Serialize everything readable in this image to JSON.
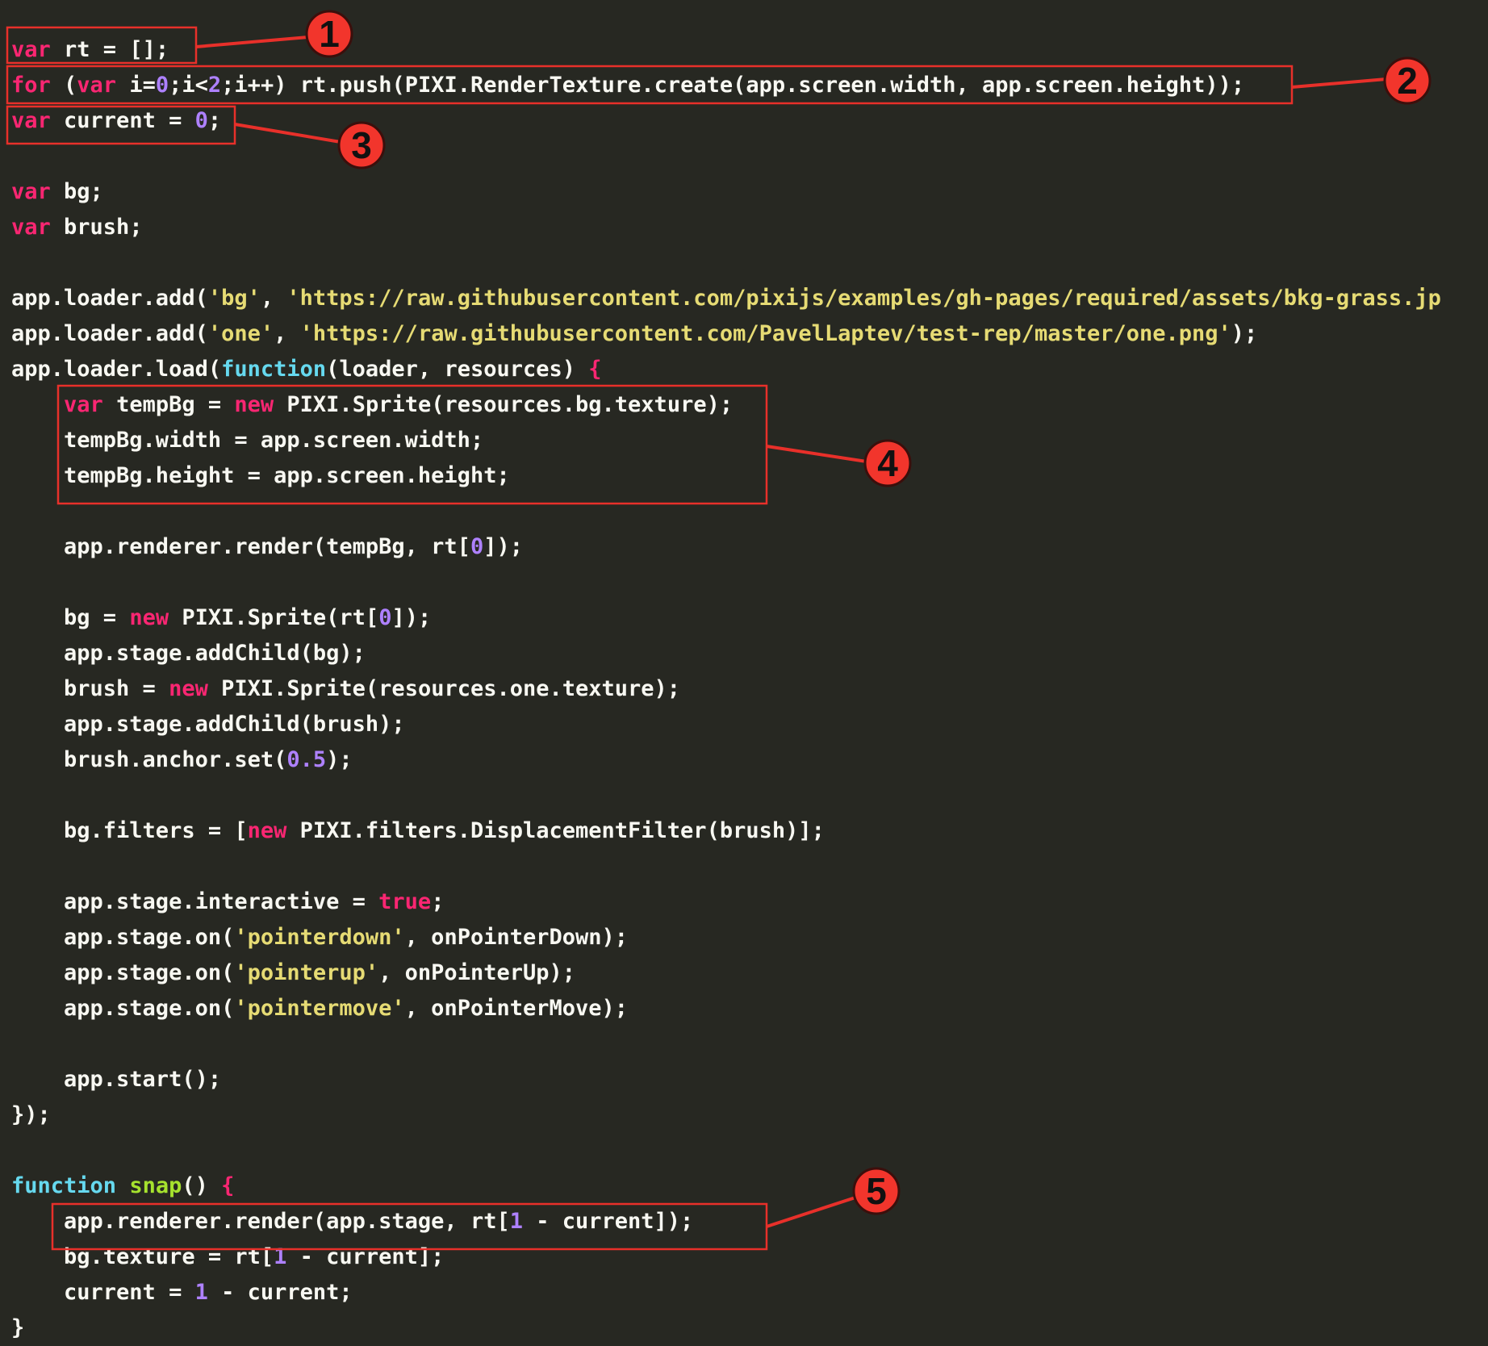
{
  "colors": {
    "background": "#272822",
    "plain": "#f8f8f2",
    "keyword": "#f92672",
    "function_keyword": "#66d9ef",
    "function_name": "#a6e22e",
    "string": "#e6db74",
    "number": "#ae81ff",
    "annotation": "#e8302a"
  },
  "code_lines": [
    [
      {
        "t": "kw",
        "v": "var"
      },
      {
        "t": "p",
        "v": " rt = [];"
      }
    ],
    [
      {
        "t": "kw",
        "v": "for"
      },
      {
        "t": "p",
        "v": " ("
      },
      {
        "t": "kw",
        "v": "var"
      },
      {
        "t": "p",
        "v": " i="
      },
      {
        "t": "num",
        "v": "0"
      },
      {
        "t": "p",
        "v": ";i<"
      },
      {
        "t": "num",
        "v": "2"
      },
      {
        "t": "p",
        "v": ";i++) rt.push(PIXI.RenderTexture.create(app.screen.width, app.screen.height));"
      }
    ],
    [
      {
        "t": "kw",
        "v": "var"
      },
      {
        "t": "p",
        "v": " current = "
      },
      {
        "t": "num",
        "v": "0"
      },
      {
        "t": "p",
        "v": ";"
      }
    ],
    [],
    [
      {
        "t": "kw",
        "v": "var"
      },
      {
        "t": "p",
        "v": " bg;"
      }
    ],
    [
      {
        "t": "kw",
        "v": "var"
      },
      {
        "t": "p",
        "v": " brush;"
      }
    ],
    [],
    [
      {
        "t": "p",
        "v": "app.loader.add("
      },
      {
        "t": "str",
        "v": "'bg'"
      },
      {
        "t": "p",
        "v": ", "
      },
      {
        "t": "str",
        "v": "'https://raw.githubusercontent.com/pixijs/examples/gh-pages/required/assets/bkg-grass.jp"
      }
    ],
    [
      {
        "t": "p",
        "v": "app.loader.add("
      },
      {
        "t": "str",
        "v": "'one'"
      },
      {
        "t": "p",
        "v": ", "
      },
      {
        "t": "str",
        "v": "'https://raw.githubusercontent.com/PavelLaptev/test-rep/master/one.png'"
      },
      {
        "t": "p",
        "v": ");"
      }
    ],
    [
      {
        "t": "p",
        "v": "app.loader.load("
      },
      {
        "t": "fn",
        "v": "function"
      },
      {
        "t": "p",
        "v": "(loader, resources) "
      },
      {
        "t": "brace",
        "v": "{"
      }
    ],
    [
      {
        "t": "p",
        "v": "    "
      },
      {
        "t": "kw",
        "v": "var"
      },
      {
        "t": "p",
        "v": " tempBg = "
      },
      {
        "t": "kw",
        "v": "new"
      },
      {
        "t": "p",
        "v": " PIXI.Sprite(resources.bg.texture);"
      }
    ],
    [
      {
        "t": "p",
        "v": "    tempBg.width = app.screen.width;"
      }
    ],
    [
      {
        "t": "p",
        "v": "    tempBg.height = app.screen.height;"
      }
    ],
    [],
    [
      {
        "t": "p",
        "v": "    app.renderer.render(tempBg, rt["
      },
      {
        "t": "num",
        "v": "0"
      },
      {
        "t": "p",
        "v": "]);"
      }
    ],
    [],
    [
      {
        "t": "p",
        "v": "    bg = "
      },
      {
        "t": "kw",
        "v": "new"
      },
      {
        "t": "p",
        "v": " PIXI.Sprite(rt["
      },
      {
        "t": "num",
        "v": "0"
      },
      {
        "t": "p",
        "v": "]);"
      }
    ],
    [
      {
        "t": "p",
        "v": "    app.stage.addChild(bg);"
      }
    ],
    [
      {
        "t": "p",
        "v": "    brush = "
      },
      {
        "t": "kw",
        "v": "new"
      },
      {
        "t": "p",
        "v": " PIXI.Sprite(resources.one.texture);"
      }
    ],
    [
      {
        "t": "p",
        "v": "    app.stage.addChild(brush);"
      }
    ],
    [
      {
        "t": "p",
        "v": "    brush.anchor.set("
      },
      {
        "t": "num",
        "v": "0.5"
      },
      {
        "t": "p",
        "v": ");"
      }
    ],
    [],
    [
      {
        "t": "p",
        "v": "    bg.filters = ["
      },
      {
        "t": "kw",
        "v": "new"
      },
      {
        "t": "p",
        "v": " PIXI.filters.DisplacementFilter(brush)];"
      }
    ],
    [],
    [
      {
        "t": "p",
        "v": "    app.stage.interactive = "
      },
      {
        "t": "kw",
        "v": "true"
      },
      {
        "t": "p",
        "v": ";"
      }
    ],
    [
      {
        "t": "p",
        "v": "    app.stage.on("
      },
      {
        "t": "str",
        "v": "'pointerdown'"
      },
      {
        "t": "p",
        "v": ", onPointerDown);"
      }
    ],
    [
      {
        "t": "p",
        "v": "    app.stage.on("
      },
      {
        "t": "str",
        "v": "'pointerup'"
      },
      {
        "t": "p",
        "v": ", onPointerUp);"
      }
    ],
    [
      {
        "t": "p",
        "v": "    app.stage.on("
      },
      {
        "t": "str",
        "v": "'pointermove'"
      },
      {
        "t": "p",
        "v": ", onPointerMove);"
      }
    ],
    [],
    [
      {
        "t": "p",
        "v": "    app.start();"
      }
    ],
    [
      {
        "t": "p",
        "v": "});"
      }
    ],
    [],
    [
      {
        "t": "fn",
        "v": "function"
      },
      {
        "t": "p",
        "v": " "
      },
      {
        "t": "name",
        "v": "snap"
      },
      {
        "t": "p",
        "v": "() "
      },
      {
        "t": "brace",
        "v": "{"
      }
    ],
    [
      {
        "t": "p",
        "v": "    app.renderer.render(app.stage, rt["
      },
      {
        "t": "num",
        "v": "1"
      },
      {
        "t": "p",
        "v": " - current]);"
      }
    ],
    [
      {
        "t": "p",
        "v": "    bg.texture = rt["
      },
      {
        "t": "num",
        "v": "1"
      },
      {
        "t": "p",
        "v": " - current];"
      }
    ],
    [
      {
        "t": "p",
        "v": "    current = "
      },
      {
        "t": "num",
        "v": "1"
      },
      {
        "t": "p",
        "v": " - current;"
      }
    ],
    [
      {
        "t": "p",
        "v": "}"
      }
    ]
  ],
  "annotations": [
    {
      "label": "1"
    },
    {
      "label": "2"
    },
    {
      "label": "3"
    },
    {
      "label": "4"
    },
    {
      "label": "5"
    }
  ]
}
